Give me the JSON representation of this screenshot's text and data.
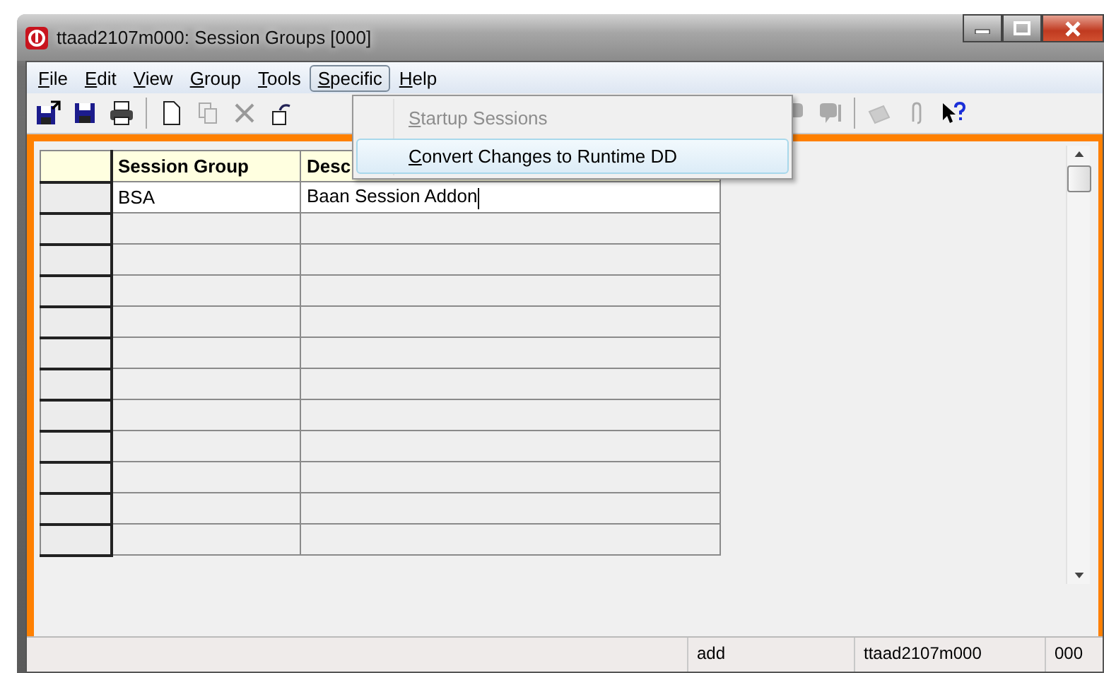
{
  "window": {
    "title": "ttaad2107m000: Session Groups [000]"
  },
  "menu_bar": [
    {
      "label": "File",
      "access_key_underlined": true,
      "selected": false
    },
    {
      "label": "Edit",
      "access_key_underlined": true,
      "selected": false
    },
    {
      "label": "View",
      "access_key_underlined": true,
      "selected": false
    },
    {
      "label": "Group",
      "access_key_underlined": true,
      "selected": false
    },
    {
      "label": "Tools",
      "access_key_underlined": true,
      "selected": false
    },
    {
      "label": "Specific",
      "access_key_underlined": true,
      "selected": true
    },
    {
      "label": "Help",
      "access_key_underlined": true,
      "selected": false
    }
  ],
  "open_menu": {
    "items": [
      {
        "label": "Startup Sessions",
        "access_key_underlined": true,
        "disabled": true,
        "highlighted": false
      },
      {
        "label": "Convert Changes to Runtime DD",
        "access_key_underlined": true,
        "disabled": false,
        "highlighted": true
      }
    ]
  },
  "table": {
    "columns": [
      {
        "label": "Session Group"
      },
      {
        "label": "Desc"
      }
    ],
    "rows": [
      {
        "cells": [
          "BSA",
          "Baan Session Addon"
        ],
        "editing": true
      }
    ]
  },
  "status_bar": [
    "add",
    "ttaad2107m000",
    "000"
  ]
}
